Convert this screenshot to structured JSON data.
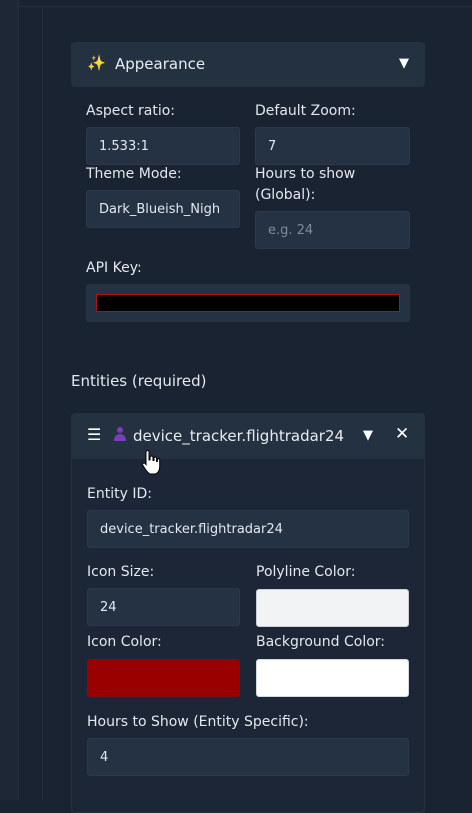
{
  "appearance": {
    "title": "Appearance",
    "aspect_ratio_label": "Aspect ratio:",
    "aspect_ratio_value": "1.533:1",
    "default_zoom_label": "Default Zoom:",
    "default_zoom_value": "7",
    "theme_mode_label": "Theme Mode:",
    "theme_mode_value": "Dark_Blueish_Nigh",
    "hours_label_line1": "Hours to show",
    "hours_label_line2": "(Global):",
    "hours_placeholder": "e.g. 24",
    "api_key_label": "API Key:"
  },
  "entities": {
    "section_label": "Entities (required)",
    "entity": {
      "title": "device_tracker.flightradar24",
      "entity_id_label": "Entity ID:",
      "entity_id_value": "device_tracker.flightradar24",
      "icon_size_label": "Icon Size:",
      "icon_size_value": "24",
      "polyline_color_label": "Polyline Color:",
      "polyline_color": "#f2f3f5",
      "icon_color_label": "Icon Color:",
      "icon_color": "#990000",
      "background_color_label": "Background Color:",
      "background_color": "#ffffff",
      "hours_label": "Hours to Show (Entity Specific):",
      "hours_value": "4"
    }
  },
  "icons": {
    "appearance": "sparkles-icon",
    "expand": "chevron-down-icon",
    "drag": "drag-handle-icon",
    "entity": "person-icon",
    "remove": "close-icon",
    "cursor": "hand-cursor-icon"
  }
}
